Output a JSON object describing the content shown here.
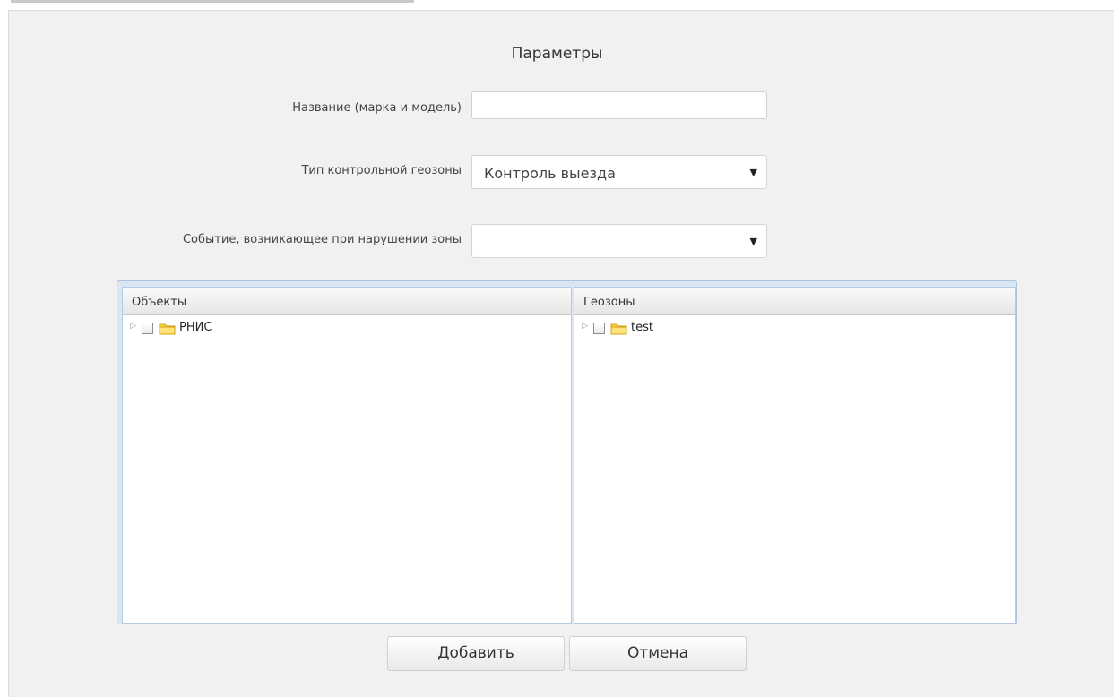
{
  "dialog": {
    "title": "Параметры"
  },
  "form": {
    "name_label": "Название (марка и модель)",
    "name_value": "",
    "geozone_type_label": "Тип контрольной геозоны",
    "geozone_type_value": "Контроль выезда",
    "event_label": "Событие, возникающее при нарушении зоны",
    "event_value": ""
  },
  "objects_pane": {
    "header": "Объекты",
    "items": [
      {
        "label": "РНИС",
        "checked": false,
        "icon": "folder-icon"
      }
    ]
  },
  "geozones_pane": {
    "header": "Геозоны",
    "items": [
      {
        "label": "test",
        "checked": false,
        "icon": "folder-icon"
      }
    ]
  },
  "buttons": {
    "add": "Добавить",
    "cancel": "Отмена"
  },
  "colors": {
    "panel_bg": "#f1f1f1",
    "grid_border": "#a9c3e0",
    "folder": "#f5c518"
  }
}
